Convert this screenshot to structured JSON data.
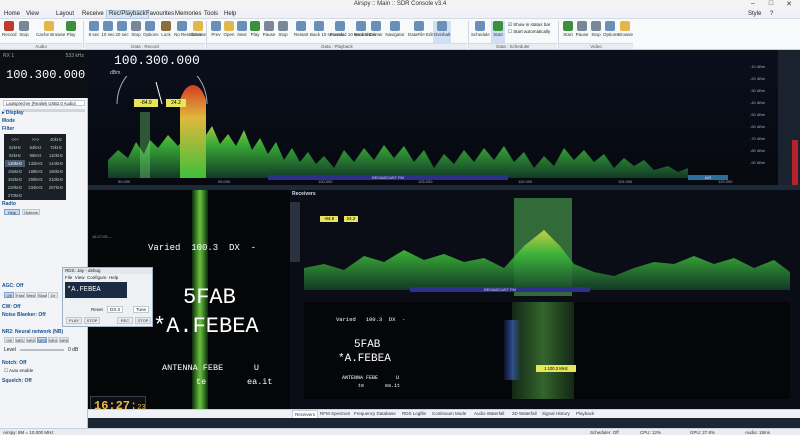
{
  "window": {
    "title": "Airspy :: Main :: SDR Console v3.4",
    "style_label": "Style",
    "help_icon": "?"
  },
  "menu": {
    "items": [
      "Home",
      "View",
      "Layout",
      "Receive",
      "Rec/Playback",
      "Favourites",
      "Memories",
      "Tools",
      "Help"
    ],
    "active": "Rec/Playback"
  },
  "ribbon": {
    "audio": {
      "group_label": "Audio",
      "buttons": [
        "Record",
        "Stop",
        "Cache Browse",
        "Play"
      ]
    },
    "data_record": {
      "group_label": "Data : Record",
      "buttons": [
        "8 sec",
        "10 sec",
        "20 sec",
        "Stop",
        "Options",
        "Lock",
        "No Restriction",
        "Browse"
      ]
    },
    "data_playback": {
      "group_label": "Data : Playback",
      "buttons": [
        "Prev",
        "Open",
        "Next",
        "Play",
        "Pause",
        "Stop",
        "Restart",
        "Back 10 seconds",
        "Forward 10 seconds",
        "Back 5 min",
        "Center",
        "Navigator",
        "DataFile Editor",
        "Ovinhalt"
      ]
    },
    "data_scheduler": {
      "group_label": "Data : Scheduler",
      "buttons": [
        "Schedule",
        "Start"
      ],
      "checks": [
        "Show in status bar",
        "Start automatically"
      ]
    },
    "video": {
      "group_label": "Video",
      "buttons": [
        "Start",
        "Pause",
        "Stop",
        "Options",
        "Browse"
      ]
    }
  },
  "left": {
    "rx_label": "RX 1",
    "khz_label": "533 kHz",
    "frequency": "100.300.000",
    "audio_device": "Lautsprecher (Realtek USB2.0 Audio)",
    "sections": [
      "Display",
      "Mode",
      "Filter"
    ],
    "filters": [
      "<<<",
      ">>>",
      "40kHz",
      "52kHz",
      "64kHz",
      "72kHz",
      "84kHz",
      "96kHz",
      "110kHz",
      "120kHz",
      "132kHz",
      "144kHz",
      "156kHz",
      "168kHz",
      "180kHz",
      "192kHz",
      "200kHz",
      "210kHz",
      "220kHz",
      "234kHz",
      "267kHz",
      "270kHz",
      "",
      ""
    ],
    "selected_filter": "120kHz",
    "radio_label": "Radio",
    "radio_tabs": [
      "Help",
      "Options"
    ],
    "agc_label": "AGC: Off",
    "agc_buttons": [
      "Off",
      "Fast",
      "Med",
      "Slow",
      "Dr"
    ],
    "cw_label": "CW: Off",
    "noise_blanker_label": "Noise Blanker: Off",
    "nr2_label": "NR2: Neural network (NB)",
    "nr2_buttons": [
      "Off",
      "NR1",
      "NR2",
      "NR3",
      "NR4",
      "NR5"
    ],
    "level_label": "Level",
    "level_value": "0 dB",
    "notch_label": "Notch: Off",
    "notch_enable": "Auto enable",
    "squelch_label": "Squelch: Off"
  },
  "main_spectrum": {
    "freq_display": "100.300.000",
    "dbm_label": "dBm",
    "meter_left": "-84.9",
    "meter_right": "24.2",
    "broadcast_label": "BROADCAST FM",
    "air_label": "AIR",
    "db_labels": [
      "-10 dBm",
      "-20 dBm",
      "-30 dBm",
      "-40 dBm",
      "-50 dBm",
      "-60 dBm",
      "-70 dBm",
      "-80 dBm",
      "-90 dBm",
      "-100 dBm",
      "-110 dBm"
    ],
    "freq_ticks": [
      "90.000",
      "95.000",
      "100.000",
      "105.000",
      "110.000",
      "115.000",
      "120.000"
    ]
  },
  "waterfall_main": {
    "time_label": "16:27:05 ---",
    "rds_line1": "Varied  100.3  DX  -",
    "rds_ps": "5FAB",
    "rds_rt": "*A.FEBEA",
    "rds_line4": "ANTENNA FEBE      U",
    "rds_line5": "te        ea.it"
  },
  "rds_dialog": {
    "title": "RDS: Jay - debug",
    "menu": [
      "File",
      "View",
      "Configure",
      "Help"
    ],
    "ps": "*A.FEBEA",
    "reset_label": "Reset",
    "reset_value": "DX.3",
    "tune_label": "Tune",
    "buttons": [
      "PLAY",
      "STOP",
      "REC",
      "STOP"
    ]
  },
  "clock": {
    "hm": "16:27",
    "sec": "23"
  },
  "receivers": {
    "title": "Receivers",
    "meter_left": "-84.9",
    "meter_right": "24.2",
    "broadcast_label": "BROADCAST FM",
    "rds_line1": "Varied   100.3  DX  -",
    "rds_ps": "5FAB",
    "rds_rt": "*A.FEBEA",
    "rds_line4": "ANTENNA FEBE      U",
    "rds_line5": "te       ea.it",
    "badge": "1  100.3 MHz"
  },
  "bottom_tabs": [
    "Receivers",
    "RFM Spectrum",
    "Frequency Database",
    "RDS Logfile",
    "Continuum Mode",
    "Audio Waterfall",
    "2D Waterfall",
    "Signal History",
    "Playback"
  ],
  "status": {
    "left": "Airspy: 8M = 10.000 MHz",
    "scheduler": "Scheduler: Off",
    "cpu": "CPU: 12%",
    "gpu": "GPU: 27.8%",
    "audio": "Audio: 18ms"
  },
  "colors": {
    "accent": "#1a4f8c",
    "spectrum_fill": "#3fbf3a",
    "broadcast_band": "#2c2f8c",
    "clock": "#e7b94a"
  }
}
